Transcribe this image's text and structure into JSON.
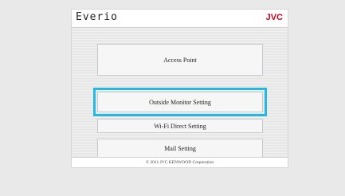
{
  "header": {
    "brand": "Everio",
    "vendor": "JVC"
  },
  "menu": {
    "items": [
      {
        "label": "Access Point"
      },
      {
        "label": "Outside Monitor Setting",
        "selected": true
      },
      {
        "label": "Wi-Fi Direct Setting"
      },
      {
        "label": "Mail Setting"
      }
    ]
  },
  "footer": {
    "copyright": "© 2011 JVC KENWOOD Corporation"
  },
  "colors": {
    "vendor": "#d0021b",
    "focus": "#23b9e6"
  }
}
